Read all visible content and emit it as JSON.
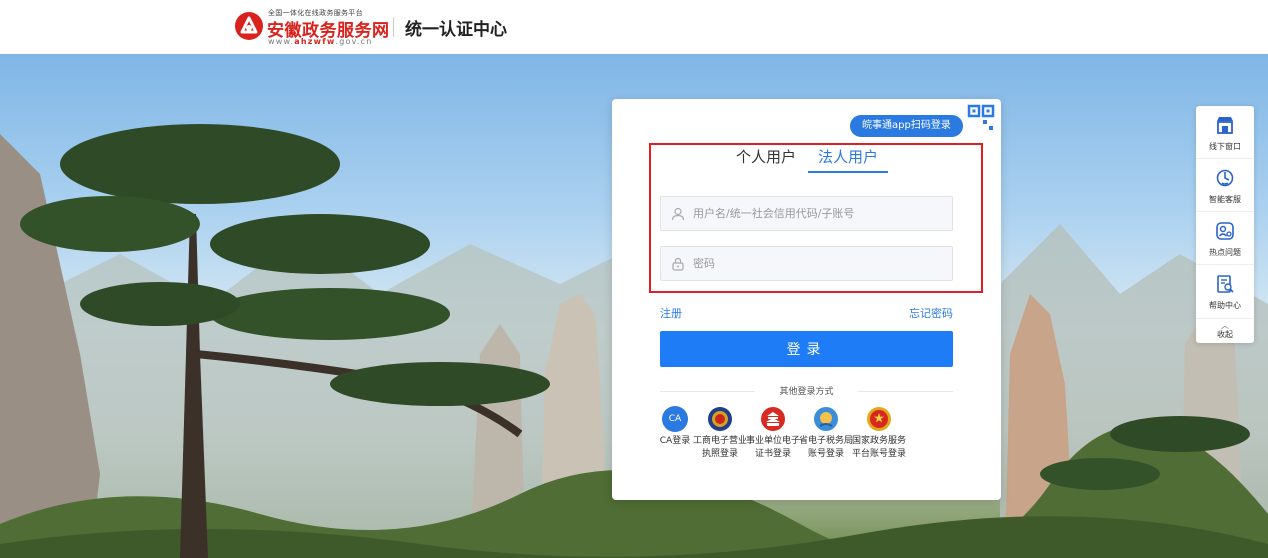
{
  "header": {
    "logo_small": "全国一体化在线政务服务平台",
    "logo_name": "安徽政务服务网",
    "logo_url_prefix": "www.",
    "logo_url_brand": "ahzwfw",
    "logo_url_suffix": ".gov.cn",
    "title": "统一认证中心"
  },
  "login": {
    "qr_login_label": "皖事通app扫码登录",
    "tabs": [
      {
        "label": "个人用户",
        "active": false
      },
      {
        "label": "法人用户",
        "active": true
      }
    ],
    "username_placeholder": "用户名/统一社会信用代码/子账号",
    "password_placeholder": "密码",
    "register_label": "注册",
    "forgot_label": "忘记密码",
    "submit_label": "登录",
    "other_methods_title": "其他登录方式",
    "other_methods": [
      {
        "icon": "ca-icon",
        "badge": "CA",
        "label": "CA登录"
      },
      {
        "icon": "emblem-icon",
        "label": "工商电子营业执照登录"
      },
      {
        "icon": "temple-icon",
        "label": "事业单位电子证书登录"
      },
      {
        "icon": "tax-icon",
        "label": "省电子税务局账号登录"
      },
      {
        "icon": "national-emblem-icon",
        "label": "国家政务服务平台账号登录"
      }
    ]
  },
  "toolbar": {
    "items": [
      {
        "icon": "storefront-icon",
        "label": "线下窗口"
      },
      {
        "icon": "robot-service-icon",
        "label": "智能客服"
      },
      {
        "icon": "hot-question-icon",
        "label": "热点问题"
      },
      {
        "icon": "help-doc-icon",
        "label": "帮助中心"
      }
    ],
    "collapse_label": "收起"
  },
  "colors": {
    "brand_red": "#d9221c",
    "accent_blue": "#1e7cf6",
    "highlight_red": "#e02020"
  }
}
